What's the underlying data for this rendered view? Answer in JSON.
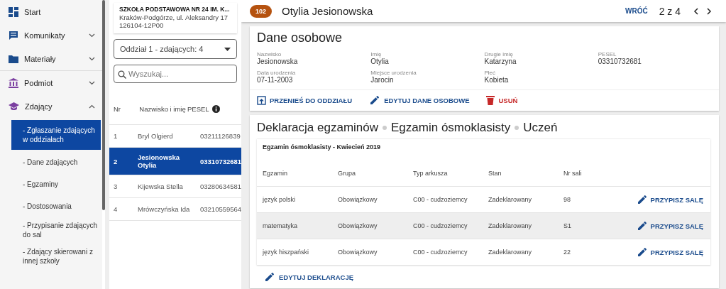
{
  "sidebar": {
    "items": [
      {
        "label": "Start"
      },
      {
        "label": "Komunikaty",
        "expanded": false
      },
      {
        "label": "Materiały",
        "expanded": false
      },
      {
        "label": "Podmiot",
        "expanded": false
      },
      {
        "label": "Zdający",
        "expanded": true,
        "children": [
          {
            "label": "- Zgłaszanie zdających w oddziałach",
            "selected": true
          },
          {
            "label": "- Dane zdających",
            "selected": false
          },
          {
            "label": "- Egzaminy",
            "selected": false
          },
          {
            "label": "- Dostosowania",
            "selected": false
          },
          {
            "label": "- Przypisanie zdających do sal",
            "selected": false
          },
          {
            "label": "- Zdający skierowani z innej szkoły",
            "selected": false
          }
        ]
      }
    ]
  },
  "school": {
    "name": "SZKOŁA PODSTAWOWA NR 24 IM. K...",
    "address": "Kraków-Podgórze, ul. Aleksandry 17",
    "code": "126104-12P00"
  },
  "class_select": {
    "value": "Oddział 1 - zdających: 4"
  },
  "search": {
    "placeholder": "Wyszukaj..."
  },
  "students": {
    "columns": [
      "Nr",
      "Nazwisko i imię",
      "PESEL"
    ],
    "rows": [
      {
        "nr": "1",
        "name": "Bryl Olgierd",
        "pesel": "03211126839",
        "selected": false
      },
      {
        "nr": "2",
        "name": "Jesionowska Otylia",
        "pesel": "03310732681",
        "selected": true
      },
      {
        "nr": "3",
        "name": "Kijewska Stella",
        "pesel": "03280634581",
        "selected": false
      },
      {
        "nr": "4",
        "name": "Mrówczyńska Ida",
        "pesel": "03210559564",
        "selected": false
      }
    ]
  },
  "header": {
    "badge": "102",
    "name": "Otylia Jesionowska",
    "back": "WRÓĆ",
    "pager": "2 z 4"
  },
  "personal": {
    "title": "Dane osobowe",
    "fields": [
      {
        "label": "Nazwisko",
        "value": "Jesionowska"
      },
      {
        "label": "Imię",
        "value": "Otylia"
      },
      {
        "label": "Drugie imię",
        "value": "Katarzyna"
      },
      {
        "label": "PESEL",
        "value": "03310732681"
      },
      {
        "label": "Data urodzenia",
        "value": "07-11-2003"
      },
      {
        "label": "Miejsce urodzenia",
        "value": "Jarocin"
      },
      {
        "label": "Płeć",
        "value": "Kobieta"
      }
    ],
    "actions": [
      {
        "label": "PRZENIEŚ DO ODDZIAŁU",
        "kind": "move"
      },
      {
        "label": "EDYTUJ DANE OSOBOWE",
        "kind": "edit"
      },
      {
        "label": "USUŃ",
        "kind": "delete"
      }
    ]
  },
  "declaration": {
    "breadcrumb": [
      "Deklaracja egzaminów",
      "Egzamin ósmoklasisty",
      "Uczeń"
    ],
    "subtitle": "Egzamin ósmoklasisty - Kwiecień 2019",
    "columns": [
      "Egzamin",
      "Grupa",
      "Typ arkusza",
      "Stan",
      "Nr sali"
    ],
    "rows": [
      {
        "cells": [
          "język polski",
          "Obowiązkowy",
          "C00 - cudzoziemcy",
          "Zadeklarowany",
          "98"
        ],
        "action": "PRZYPISZ SALĘ",
        "highlighted": false
      },
      {
        "cells": [
          "matematyka",
          "Obowiązkowy",
          "C00 - cudzoziemcy",
          "Zadeklarowany",
          "S1"
        ],
        "action": "PRZYPISZ SALĘ",
        "highlighted": true
      },
      {
        "cells": [
          "język hiszpański",
          "Obowiązkowy",
          "C00 - cudzoziemcy",
          "Zadeklarowany",
          "22"
        ],
        "action": "PRZYPISZ SALĘ",
        "highlighted": false
      }
    ],
    "edit": "EDYTUJ DEKLARACJĘ"
  }
}
